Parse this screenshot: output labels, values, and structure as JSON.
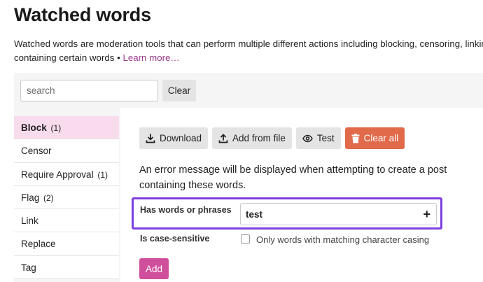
{
  "page": {
    "title": "Watched words",
    "description_line1": "Watched words are moderation tools that can perform multiple different actions including blocking, censoring, linking",
    "description_line2": "containing certain words • ",
    "learn_more": "Learn more…"
  },
  "filter": {
    "search_placeholder": "search",
    "clear_label": "Clear"
  },
  "sidebar": {
    "items": [
      {
        "label": "Block",
        "count": "(1)"
      },
      {
        "label": "Censor",
        "count": ""
      },
      {
        "label": "Require Approval",
        "count": "(1)"
      },
      {
        "label": "Flag",
        "count": "(2)"
      },
      {
        "label": "Link",
        "count": ""
      },
      {
        "label": "Replace",
        "count": ""
      },
      {
        "label": "Tag",
        "count": ""
      }
    ]
  },
  "toolbar": {
    "download_label": "Download",
    "add_from_file_label": "Add from file",
    "test_label": "Test",
    "clear_all_label": "Clear all"
  },
  "action": {
    "description": "An error message will be displayed when attempting to create a post containing these words."
  },
  "form": {
    "words_label": "Has words or phrases",
    "words_value": "test",
    "case_label": "Is case-sensitive",
    "case_option_text": "Only words with matching character casing",
    "add_label": "Add"
  },
  "colors": {
    "accent": "#d04f9c",
    "danger": "#e06a4a",
    "highlight": "#7d3fe0",
    "active_tab_bg": "#f8dcee"
  }
}
